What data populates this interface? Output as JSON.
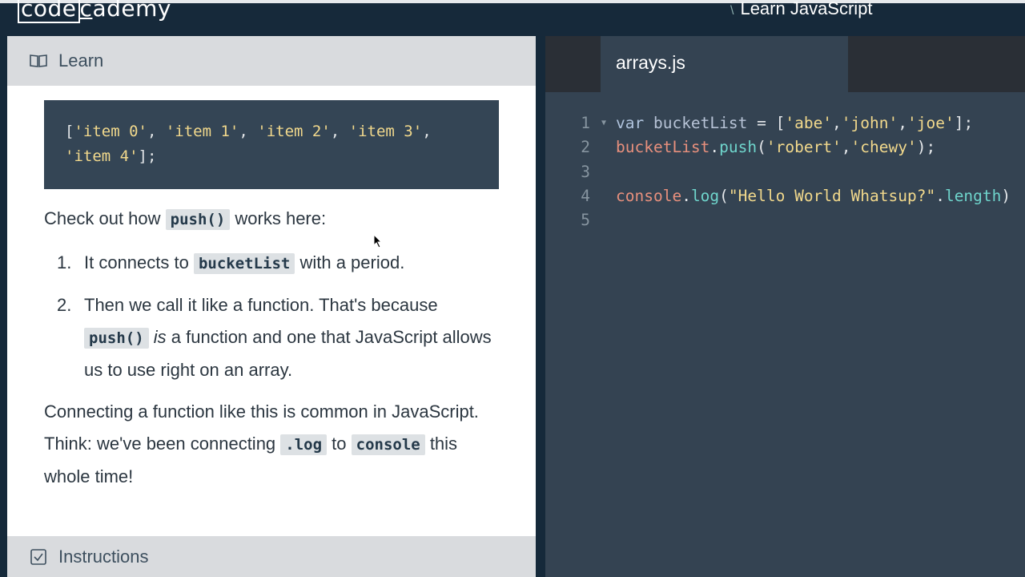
{
  "header": {
    "logo": {
      "part1": "code",
      "part2": "c",
      "part3": "ademy"
    },
    "course_title": "Learn JavaScript"
  },
  "learn_panel": {
    "title": "Learn",
    "icon": "book-icon",
    "code_example": {
      "line1": [
        "[",
        "'item 0'",
        ", ",
        "'item 1'",
        ", ",
        "'item 2'",
        ", ",
        "'item 3'",
        ","
      ],
      "line2": [
        "'item 4'",
        "];"
      ]
    },
    "intro": {
      "before": "Check out how ",
      "code": "push()",
      "after": " works here:"
    },
    "steps": [
      {
        "num": "1.",
        "before": "It connects to ",
        "code": "bucketList",
        "after": " with a period."
      },
      {
        "num": "2.",
        "before": "Then we call it like a function. That's because ",
        "code": "push()",
        "em": "is",
        "after": " a function and one that JavaScript allows us to use right on an array."
      }
    ],
    "outro": {
      "before": "Connecting a function like this is common in JavaScript. Think: we've been connecting ",
      "code1": ".log",
      "mid": " to ",
      "code2": "console",
      "after": " this whole time!"
    }
  },
  "instructions_panel": {
    "title": "Instructions",
    "icon": "checkbox-icon"
  },
  "editor": {
    "tab_label": "arrays.js",
    "lines": [
      {
        "num": "1",
        "tokens": [
          [
            "kw",
            "var "
          ],
          [
            "id",
            "bucketList "
          ],
          [
            "pn",
            "= ["
          ],
          [
            "str",
            "'abe'"
          ],
          [
            "pn",
            ","
          ],
          [
            "str",
            "'john'"
          ],
          [
            "pn",
            ","
          ],
          [
            "str",
            "'joe'"
          ],
          [
            "pn",
            "];"
          ]
        ]
      },
      {
        "num": "2",
        "tokens": [
          [
            "obj",
            "bucketList"
          ],
          [
            "pn",
            "."
          ],
          [
            "fn",
            "push"
          ],
          [
            "pn",
            "("
          ],
          [
            "str",
            "'robert'"
          ],
          [
            "pn",
            ","
          ],
          [
            "str",
            "'chewy'"
          ],
          [
            "pn",
            ");"
          ]
        ]
      },
      {
        "num": "3",
        "tokens": []
      },
      {
        "num": "4",
        "tokens": [
          [
            "obj",
            "console"
          ],
          [
            "pn",
            "."
          ],
          [
            "fn",
            "log"
          ],
          [
            "pn",
            "("
          ],
          [
            "str",
            "\"Hello World Whatsup?\""
          ],
          [
            "pn",
            "."
          ],
          [
            "fn",
            "length"
          ],
          [
            "pn",
            ")"
          ]
        ]
      },
      {
        "num": "5",
        "tokens": []
      }
    ]
  }
}
